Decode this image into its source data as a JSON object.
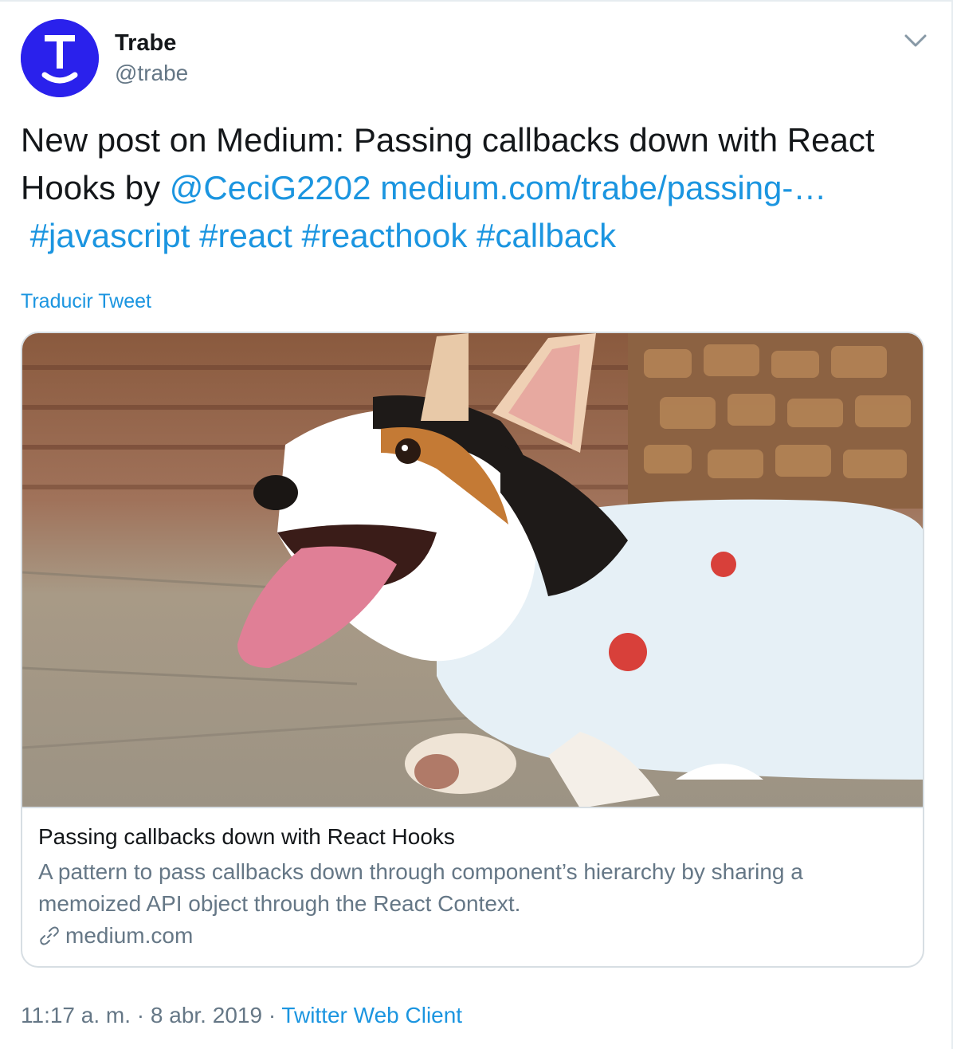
{
  "author": {
    "name": "Trabe",
    "handle": "@trabe",
    "avatar_letter": "T",
    "avatar_color": "#2a21ec",
    "avatar_icon": "trabe-logo-icon"
  },
  "menu_icon": "chevron-down-icon",
  "tweet": {
    "line1": "New post on Medium: Passing callbacks down with React",
    "line2_prefix": "Hooks by ",
    "mention": "@CeciG2202",
    "url": "medium.com/trabe/passing-…",
    "hashtags": [
      "#javascript",
      "#react",
      "#reacthook",
      "#callback"
    ]
  },
  "translate_label": "Traducir Tweet",
  "card": {
    "image_description_icon": "corgi-photo",
    "title": "Passing callbacks down with React Hooks",
    "description": "A pattern to pass callbacks down through component’s hierarchy by sharing a memoized API object through the React Context.",
    "domain": "medium.com",
    "domain_icon": "link-icon"
  },
  "meta": {
    "time": "11:17 a. m.",
    "separator": "·",
    "date": "8 abr. 2019",
    "source": "Twitter Web Client"
  },
  "colors": {
    "link": "#1b95e0",
    "secondary_text": "#657786",
    "primary_text": "#14171a",
    "border": "#d7dee3"
  }
}
